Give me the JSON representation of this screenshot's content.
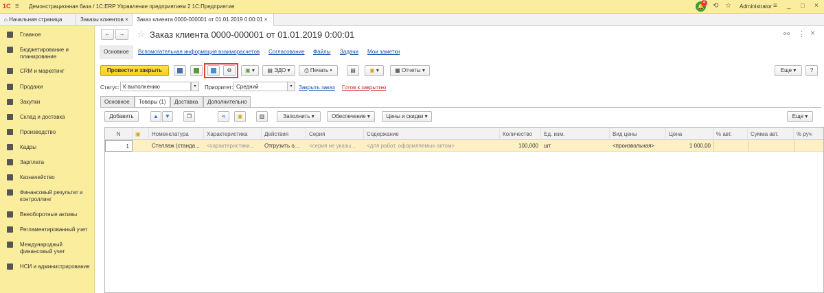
{
  "app": {
    "logo": "1С",
    "title": "Демонстрационная база / 1С:ERP Управление предприятием 2 1С:Предприятие",
    "notifications_count": "4",
    "user": "Administrator"
  },
  "window_tabs": {
    "home": "Начальная страница",
    "orders": "Заказы клиентов",
    "current": "Заказ клиента 0000-000001 от 01.01.2019 0:00:01",
    "close": "×"
  },
  "sidebar": {
    "items": [
      {
        "label": "Главное"
      },
      {
        "label": "Бюджетирование и планирование"
      },
      {
        "label": "CRM и маркетинг"
      },
      {
        "label": "Продажи"
      },
      {
        "label": "Закупки"
      },
      {
        "label": "Склад и доставка"
      },
      {
        "label": "Производство"
      },
      {
        "label": "Кадры"
      },
      {
        "label": "Зарплата"
      },
      {
        "label": "Казначейство"
      },
      {
        "label": "Финансовый результат и контроллинг"
      },
      {
        "label": "Внеоборотные активы"
      },
      {
        "label": "Регламентированный учет"
      },
      {
        "label": "Международный финансовый учет"
      },
      {
        "label": "НСИ и администрирование"
      }
    ]
  },
  "document": {
    "title": "Заказ клиента 0000-000001 от 01.01.2019 0:00:01",
    "back": "←",
    "forward": "→",
    "star": "☆",
    "link_icon": "⚯",
    "more_icon": "⋮",
    "close_icon": "×"
  },
  "form_tabs": {
    "main": "Основное",
    "settlements": "Вспомогательная информация взаиморасчетов",
    "approvals": "Согласование",
    "files": "Файлы",
    "tasks": "Задачи",
    "notes": "Мои заметки"
  },
  "toolbar": {
    "post_close": "Провести и закрыть",
    "edo": "ЭДО",
    "print": "Печать",
    "reports": "Отчеты",
    "more": "Еще",
    "help": "?"
  },
  "fields": {
    "status_label": "Статус:",
    "status_value": "К выполнению",
    "priority_label": "Приоритет:",
    "priority_value": "Средний",
    "close_order_link": "Закрыть заказ",
    "ready_to_close_link": "Готов к закрытию"
  },
  "inner_tabs": {
    "main": "Основное",
    "goods": "Товары (1)",
    "delivery": "Доставка",
    "extra": "Дополнительно"
  },
  "grid_toolbar": {
    "add": "Добавить",
    "fill": "Заполнить",
    "provision": "Обеспечение",
    "prices": "Цены и скидки",
    "more": "Еще"
  },
  "table": {
    "columns": [
      "N",
      "",
      "Номенклатура",
      "Характеристика",
      "Действия",
      "Серия",
      "Содержание",
      "Количество",
      "Ед. изм.",
      "Вид цены",
      "Цена",
      "% авт.",
      "Сумма авт.",
      "% руч"
    ],
    "rows": [
      {
        "n": "1",
        "item": "Стеллаж (станда...",
        "characteristic": "<характеристики...",
        "action": "Отгрузить о...",
        "series": "<серия не указы...",
        "content": "<для работ, оформляемых актом>",
        "quantity": "100,000",
        "unit": "шт",
        "price_type": "<произвольная>",
        "price": "1 000,00"
      }
    ]
  },
  "colors": {
    "accent_yellow": "#fbed9e",
    "primary_button": "#f8cf14",
    "link_blue": "#1a4fb0",
    "link_red": "#c62828",
    "selected_row": "#fdf1c4"
  }
}
